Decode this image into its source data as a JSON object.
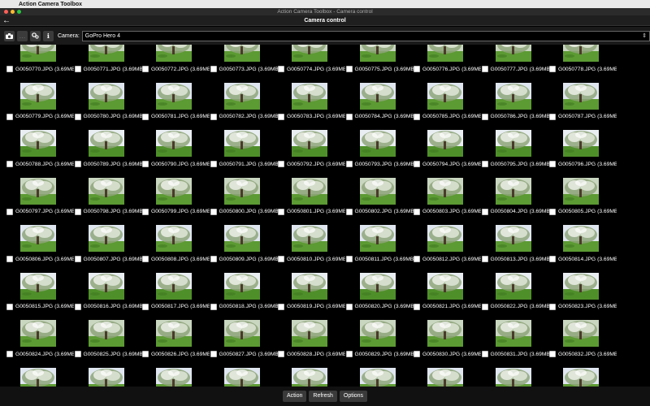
{
  "menubar": {
    "app_name": "Action Camera Toolbox"
  },
  "window": {
    "title": "Action Camera Toolbox - Camera control"
  },
  "header": {
    "title": "Camera control"
  },
  "toolbar": {
    "camera_label": "Camera:",
    "camera_selected": "GoPro Hero 4",
    "buttons": [
      "camera-icon",
      "more-icon",
      "settings-icon",
      "info-icon"
    ]
  },
  "grid": {
    "file_size": "(3.69MB)",
    "files": [
      "G0050770.JPG",
      "G0050771.JPG",
      "G0050772.JPG",
      "G0050773.JPG",
      "G0050774.JPG",
      "G0050775.JPG",
      "G0050776.JPG",
      "G0050777.JPG",
      "G0050778.JPG",
      "G0050779.JPG",
      "G0050780.JPG",
      "G0050781.JPG",
      "G0050782.JPG",
      "G0050783.JPG",
      "G0050784.JPG",
      "G0050785.JPG",
      "G0050786.JPG",
      "G0050787.JPG",
      "G0050788.JPG",
      "G0050789.JPG",
      "G0050790.JPG",
      "G0050791.JPG",
      "G0050792.JPG",
      "G0050793.JPG",
      "G0050794.JPG",
      "G0050795.JPG",
      "G0050796.JPG",
      "G0050797.JPG",
      "G0050798.JPG",
      "G0050799.JPG",
      "G0050800.JPG",
      "G0050801.JPG",
      "G0050802.JPG",
      "G0050803.JPG",
      "G0050804.JPG",
      "G0050805.JPG",
      "G0050806.JPG",
      "G0050807.JPG",
      "G0050808.JPG",
      "G0050809.JPG",
      "G0050810.JPG",
      "G0050811.JPG",
      "G0050812.JPG",
      "G0050813.JPG",
      "G0050814.JPG",
      "G0050815.JPG",
      "G0050816.JPG",
      "G0050817.JPG",
      "G0050818.JPG",
      "G0050819.JPG",
      "G0050820.JPG",
      "G0050821.JPG",
      "G0050822.JPG",
      "G0050823.JPG",
      "G0050824.JPG",
      "G0050825.JPG",
      "G0050826.JPG",
      "G0050827.JPG",
      "G0050828.JPG",
      "G0050829.JPG",
      "G0050830.JPG",
      "G0050831.JPG",
      "G0050832.JPG",
      "G0050833.JPG",
      "G0050834.JPG",
      "G0050835.JPG",
      "G0050836.JPG",
      "G0050837.JPG",
      "G0050838.JPG",
      "G0050839.JPG",
      "G0050840.JPG",
      "G0050841.JPG"
    ]
  },
  "bottom": {
    "action_label": "Action",
    "refresh_label": "Refresh",
    "options_label": "Options"
  }
}
